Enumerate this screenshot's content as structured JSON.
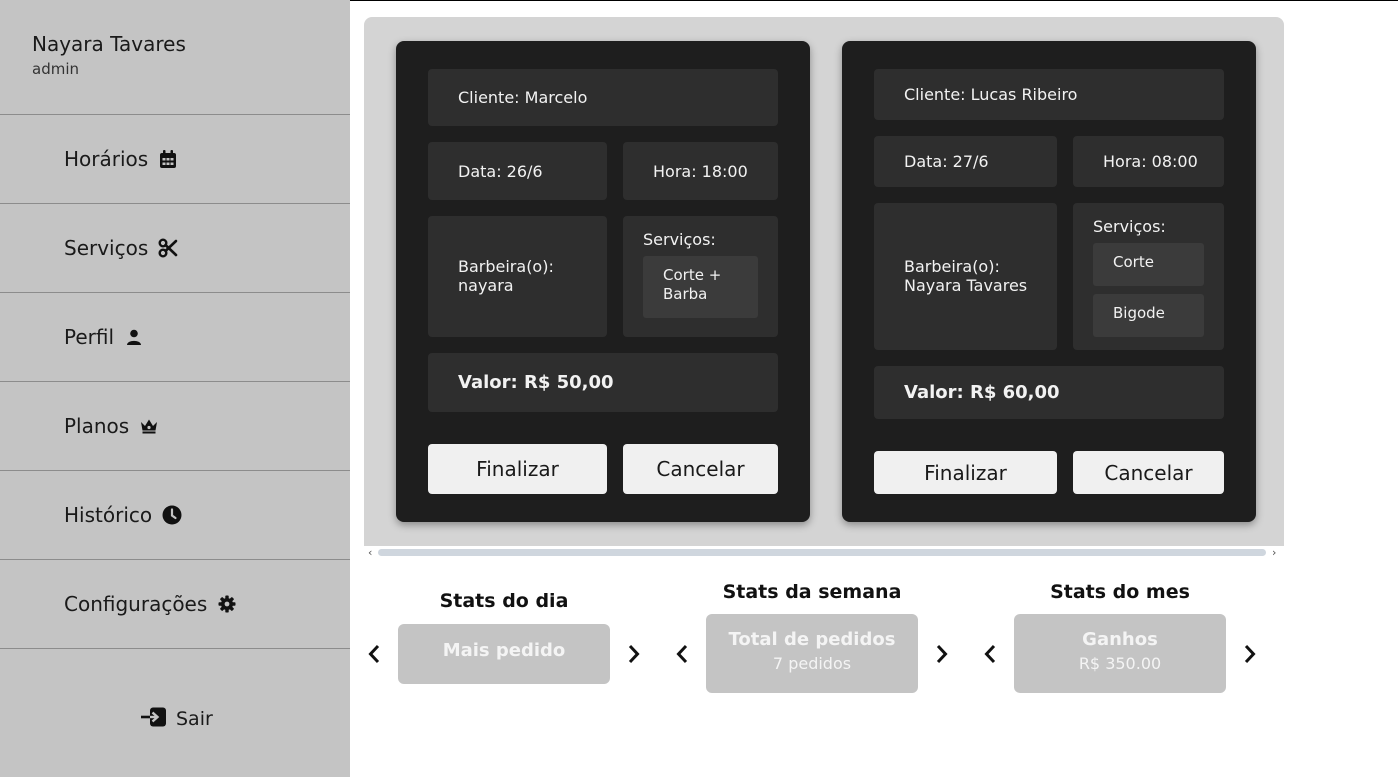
{
  "user": {
    "name": "Nayara Tavares",
    "role": "admin"
  },
  "nav": [
    {
      "label": "Horários",
      "icon": "calendar-icon"
    },
    {
      "label": "Serviços",
      "icon": "scissors-icon"
    },
    {
      "label": "Perfil",
      "icon": "user-icon"
    },
    {
      "label": "Planos",
      "icon": "crown-icon"
    },
    {
      "label": "Histórico",
      "icon": "clock-icon"
    },
    {
      "label": "Configurações",
      "icon": "gear-icon"
    }
  ],
  "logout": {
    "label": "Sair",
    "icon": "sign-in-icon"
  },
  "appointments": [
    {
      "cliente": "Cliente: Marcelo",
      "data": "Data: 26/6",
      "hora": "Hora: 18:00",
      "barbeiro": "Barbeira(o):",
      "barbeiro_nome": "nayara",
      "servicos_label": "Serviços:",
      "servicos": [
        "Corte +\nBarba"
      ],
      "valor": "Valor: R$ 50,00",
      "finalizar": "Finalizar",
      "cancelar": "Cancelar"
    },
    {
      "cliente": "Cliente: Lucas Ribeiro",
      "data": "Data: 27/6",
      "hora": "Hora: 08:00",
      "barbeiro": "Barbeira(o):",
      "barbeiro_nome": "Nayara Tavares",
      "servicos_label": "Serviços:",
      "servicos": [
        "Corte",
        "Bigode"
      ],
      "valor": "Valor: R$ 60,00",
      "finalizar": "Finalizar",
      "cancelar": "Cancelar"
    }
  ],
  "stats": [
    {
      "title": "Stats do dia",
      "main": "Mais pedido",
      "sub": ""
    },
    {
      "title": "Stats da semana",
      "main": "Total de pedidos",
      "sub": "7 pedidos"
    },
    {
      "title": "Stats do mes",
      "main": "Ganhos",
      "sub": "R$ 350.00"
    }
  ]
}
